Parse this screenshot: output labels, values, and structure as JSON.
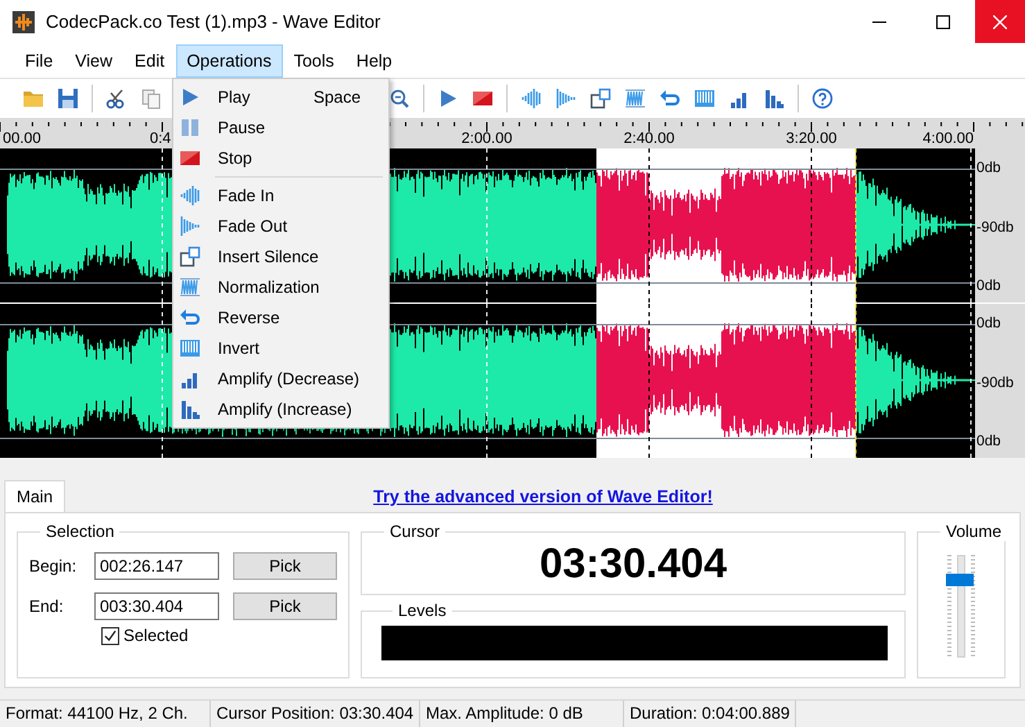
{
  "window": {
    "title": "CodecPack.co Test (1).mp3 - Wave Editor"
  },
  "menu_bar": [
    {
      "label": "File",
      "selected": false
    },
    {
      "label": "View",
      "selected": false
    },
    {
      "label": "Edit",
      "selected": false
    },
    {
      "label": "Operations",
      "selected": true
    },
    {
      "label": "Tools",
      "selected": false
    },
    {
      "label": "Help",
      "selected": false
    }
  ],
  "operations_menu": {
    "items": [
      {
        "kind": "item",
        "label": "Play",
        "shortcut": "Space"
      },
      {
        "kind": "item",
        "label": "Pause"
      },
      {
        "kind": "item",
        "label": "Stop"
      },
      {
        "kind": "separator"
      },
      {
        "kind": "item",
        "label": "Fade In"
      },
      {
        "kind": "item",
        "label": "Fade Out"
      },
      {
        "kind": "item",
        "label": "Insert Silence"
      },
      {
        "kind": "item",
        "label": "Normalization"
      },
      {
        "kind": "item",
        "label": "Reverse"
      },
      {
        "kind": "item",
        "label": "Invert"
      },
      {
        "kind": "item",
        "label": "Amplify (Decrease)"
      },
      {
        "kind": "item",
        "label": "Amplify (Increase)"
      }
    ]
  },
  "ruler": {
    "labels": [
      "00.00",
      "0:4",
      "2:00.00",
      "2:40.00",
      "3:20.00",
      "4:00.00"
    ]
  },
  "channels": [
    {
      "db_labels": [
        "0db",
        "-90db",
        "0db"
      ]
    },
    {
      "db_labels": [
        "0db",
        "-90db",
        "0db"
      ]
    }
  ],
  "tabs": [
    {
      "label": "Main",
      "selected": true
    }
  ],
  "promo_link": "Try the advanced version of Wave Editor!",
  "selection": {
    "title": "Selection",
    "begin_label": "Begin:",
    "begin_value": "002:26.147",
    "end_label": "End:",
    "end_value": "003:30.404",
    "pick_buttons": [
      "Pick",
      "Pick"
    ],
    "selected_checkbox": {
      "label": "Selected",
      "checked": true
    }
  },
  "cursor": {
    "title": "Cursor",
    "time": "03:30.404"
  },
  "levels": {
    "title": "Levels"
  },
  "volume": {
    "title": "Volume",
    "level": 0.76
  },
  "status_bar": [
    "Format: 44100 Hz, 2 Ch.",
    "Cursor Position: 03:30.404",
    "Max. Amplitude: 0 dB",
    "Duration: 0:04:00.889"
  ]
}
